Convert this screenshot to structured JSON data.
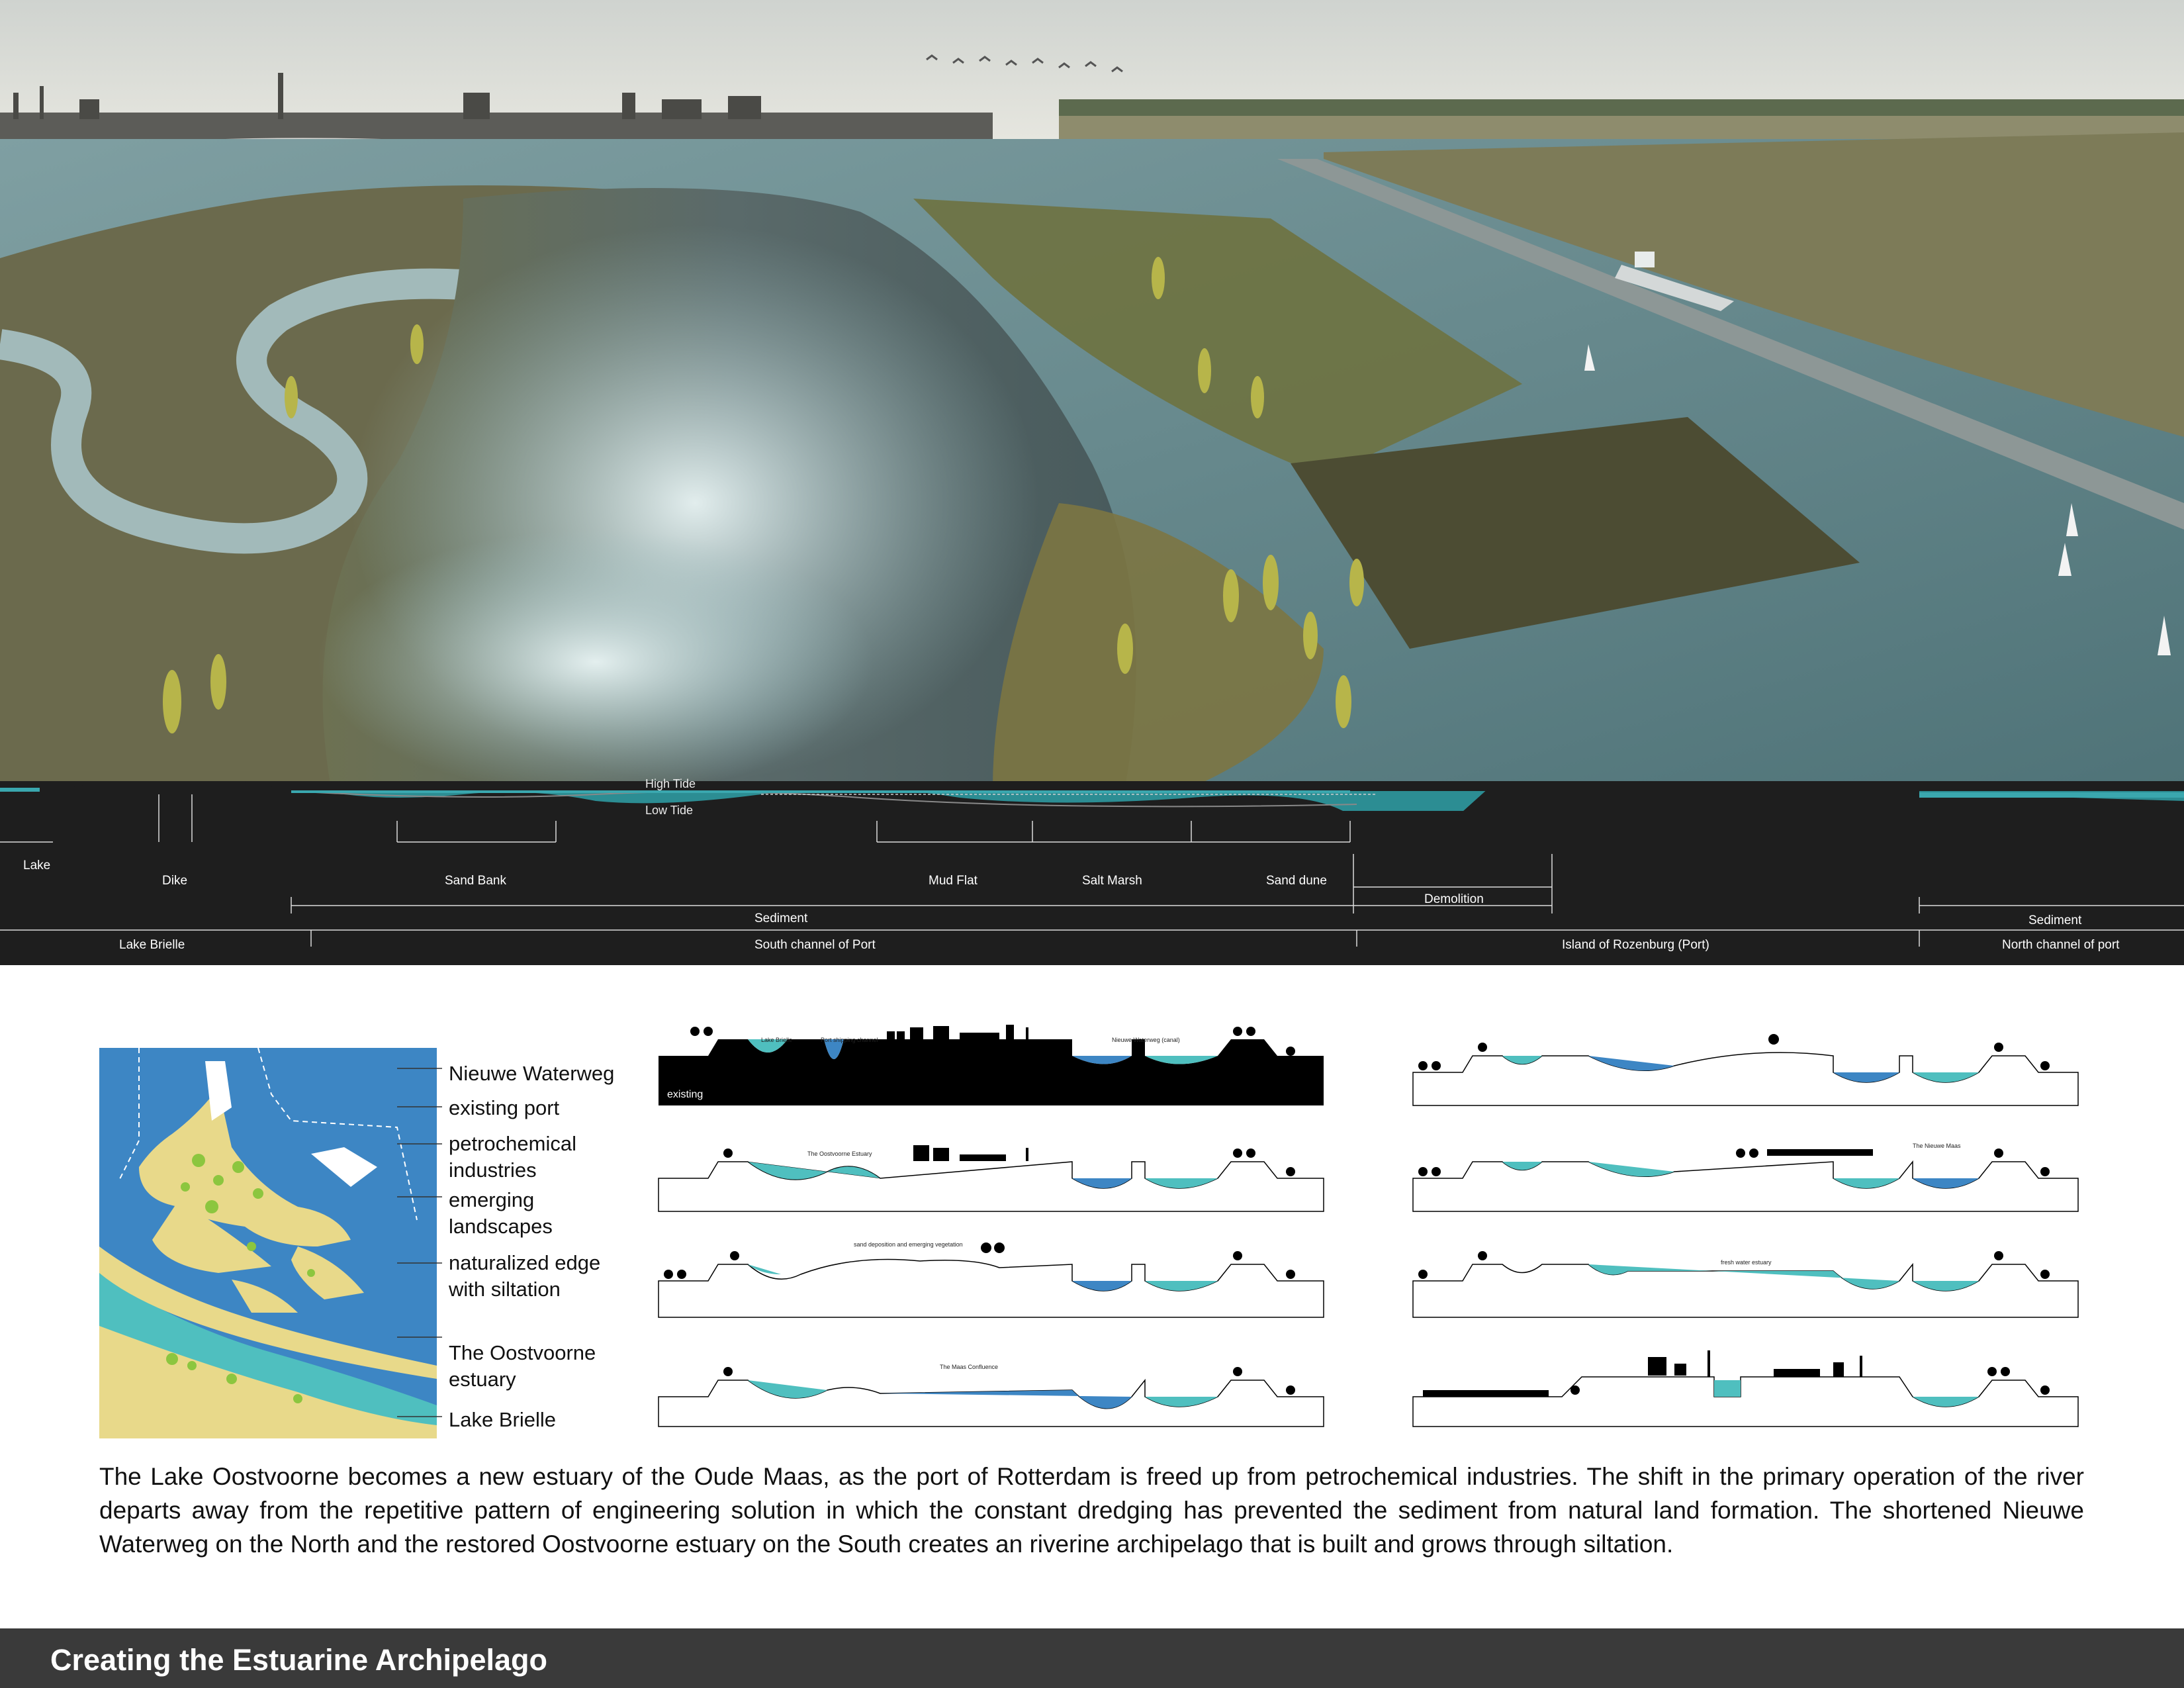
{
  "hero": {
    "tide_labels": {
      "high": "High Tide",
      "low": "Low Tide"
    }
  },
  "section": {
    "row1": {
      "lake": "Lake",
      "dike": "Dike",
      "sand_bank": "Sand Bank",
      "mud_flat": "Mud Flat",
      "salt_marsh": "Salt Marsh",
      "sand_dune": "Sand dune",
      "demolition": "Demolition"
    },
    "row2": {
      "sediment_left": "Sediment",
      "sediment_right": "Sediment"
    },
    "row3": {
      "lake_brielle": "Lake Brielle",
      "south_channel": "South channel of Port",
      "island_rozenburg": "Island of Rozenburg (Port)",
      "north_channel": "North channel of port"
    }
  },
  "map": {
    "legend": [
      "Nieuwe Waterweg",
      "existing port",
      "petrochemical industries",
      "emerging landscapes",
      "naturalized edge with siltation",
      "The Oostvoorne estuary",
      "Lake Brielle"
    ],
    "colors": {
      "water_blue": "#3d86c4",
      "teal": "#4fbfbf",
      "sand": "#e8d98a",
      "green": "#8cc63f"
    }
  },
  "sections_left": {
    "s1": {
      "existing": "existing",
      "lake_brielle": "Lake Brielle",
      "port_channel": "Port shipping channel",
      "nieuwe": "Nieuwe Waterweg (canal)"
    },
    "s2": {
      "oostvoorne": "The Oostvoorne Estuary"
    },
    "s3": {
      "sand_dep": "sand deposition and emerging vegetation"
    },
    "s4": {
      "confluence": "The Maas Confluence"
    }
  },
  "sections_right": {
    "s2": {
      "nieuwe_maas": "The Nieuwe Maas"
    },
    "s3": {
      "fresh_water": "fresh water estuary"
    }
  },
  "caption": "The Lake Oostvoorne becomes a new estuary of the Oude Maas, as the port of Rotterdam is freed up from petrochemical industries. The shift in the primary operation of the river departs away from the repetitive pattern of engineering solution in which the constant dredging has prevented the sediment from natural land formation. The shortened Nieuwe Waterweg on the North and the restored Oostvoorne estuary on the South creates an riverine archipelago that is built and grows through siltation.",
  "footer": {
    "title": "Creating the Estuarine Archipelago"
  }
}
